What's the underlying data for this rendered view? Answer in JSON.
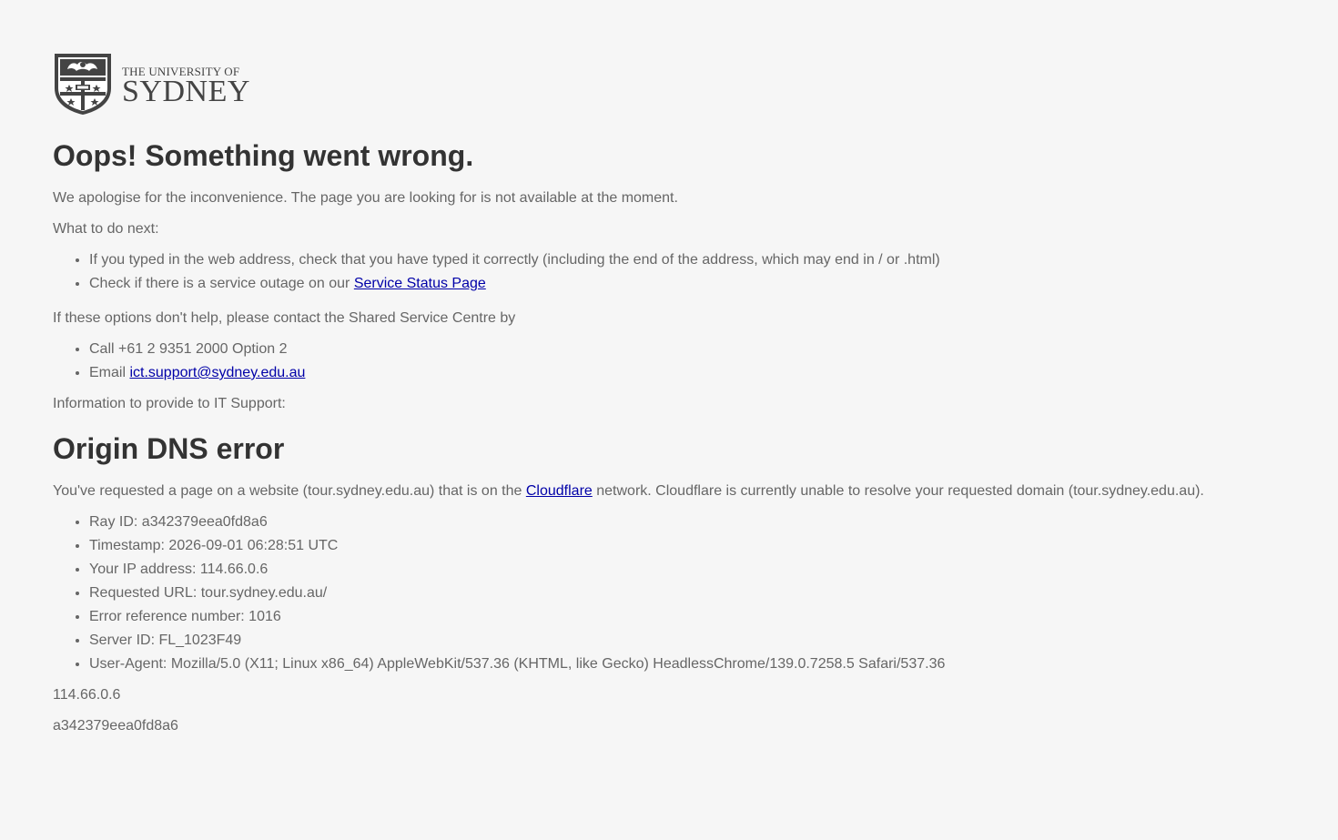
{
  "logo": {
    "line1": "THE UNIVERSITY OF",
    "line2": "SYDNEY"
  },
  "heading": "Oops! Something went wrong.",
  "apology": "We apologise for the inconvenience. The page you are looking for is not available at the moment.",
  "next_label": "What to do next:",
  "next_items": {
    "item1": "If you typed in the web address, check that you have typed it correctly (including the end of the address, which may end in / or .html)",
    "item2_prefix": "Check if there is a service outage on our ",
    "item2_link": "Service Status Page"
  },
  "contact_intro": "If these options don't help, please contact the Shared Service Centre by",
  "contact_items": {
    "call": "Call +61 2 9351 2000 Option 2",
    "email_prefix": "Email ",
    "email_link": "ict.support@sydney.edu.au"
  },
  "info_label": "Information to provide to IT Support:",
  "error": {
    "title": "Origin DNS error",
    "desc_prefix": "You've requested a page on a website (tour.sydney.edu.au) that is on the ",
    "desc_link": "Cloudflare",
    "desc_suffix": " network. Cloudflare is currently unable to resolve your requested domain (tour.sydney.edu.au).",
    "details": {
      "ray_id": "Ray ID: a342379eea0fd8a6",
      "timestamp": "Timestamp: 2026-09-01 06:28:51 UTC",
      "ip": "Your IP address: 114.66.0.6",
      "url": "Requested URL: tour.sydney.edu.au/",
      "ref": "Error reference number: 1016",
      "server": "Server ID: FL_1023F49",
      "ua": "User-Agent: Mozilla/5.0 (X11; Linux x86_64) AppleWebKit/537.36 (KHTML, like Gecko) HeadlessChrome/139.0.7258.5 Safari/537.36"
    }
  },
  "footer_ip": "114.66.0.6",
  "footer_ray": "a342379eea0fd8a6",
  "colors": {
    "background": "#f6f6f6",
    "text": "#666666",
    "heading": "#333333",
    "link": "#0000a8"
  }
}
